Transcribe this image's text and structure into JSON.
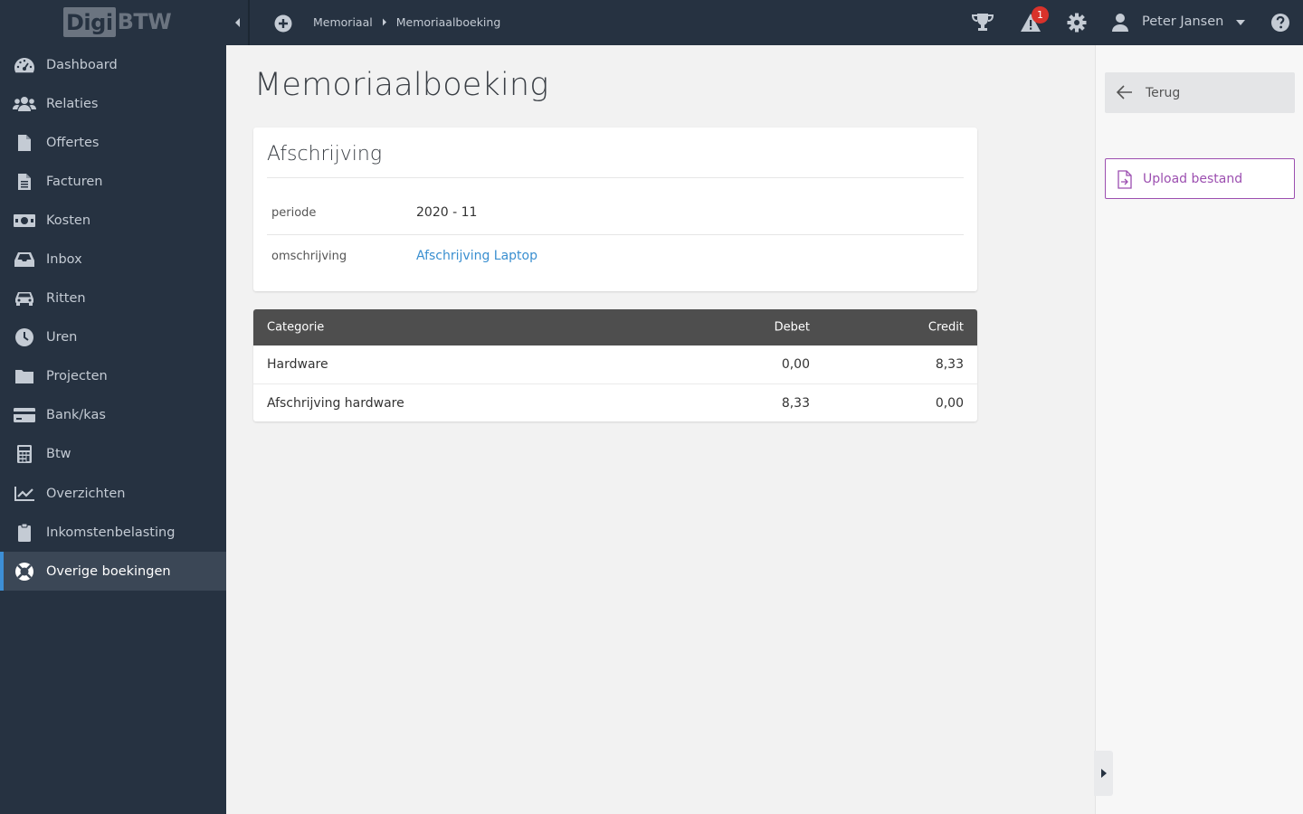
{
  "logo": {
    "part1": "Digi",
    "part2": "BTW"
  },
  "sidebar": {
    "items": [
      {
        "label": "Dashboard",
        "icon": "dashboard-icon"
      },
      {
        "label": "Relaties",
        "icon": "users-icon"
      },
      {
        "label": "Offertes",
        "icon": "file-icon"
      },
      {
        "label": "Facturen",
        "icon": "file-text-icon"
      },
      {
        "label": "Kosten",
        "icon": "money-icon"
      },
      {
        "label": "Inbox",
        "icon": "inbox-icon"
      },
      {
        "label": "Ritten",
        "icon": "car-icon"
      },
      {
        "label": "Uren",
        "icon": "clock-icon"
      },
      {
        "label": "Projecten",
        "icon": "folder-icon"
      },
      {
        "label": "Bank/kas",
        "icon": "credit-card-icon"
      },
      {
        "label": "Btw",
        "icon": "calculator-icon"
      },
      {
        "label": "Overzichten",
        "icon": "chart-line-icon"
      },
      {
        "label": "Inkomstenbelasting",
        "icon": "clipboard-icon"
      },
      {
        "label": "Overige boekingen",
        "icon": "life-ring-icon",
        "active": true
      }
    ]
  },
  "topbar": {
    "breadcrumb": [
      "Memoriaal",
      "Memoriaalboeking"
    ],
    "notification_count": "1",
    "user_name": "Peter Jansen"
  },
  "main": {
    "title": "Memoriaalboeking",
    "card": {
      "title": "Afschrijving",
      "fields": [
        {
          "label": "periode",
          "value": "2020 - 11"
        },
        {
          "label": "omschrijving",
          "value": "Afschrijving Laptop"
        }
      ]
    },
    "table": {
      "headers": {
        "category": "Categorie",
        "debit": "Debet",
        "credit": "Credit"
      },
      "rows": [
        {
          "category": "Hardware",
          "debit": "0,00",
          "credit": "8,33"
        },
        {
          "category": "Afschrijving hardware",
          "debit": "8,33",
          "credit": "0,00"
        }
      ]
    }
  },
  "right_panel": {
    "back_label": "Terug",
    "upload_label": "Upload bestand"
  },
  "colors": {
    "sidebar_bg": "#263241",
    "active_accent": "#3d8fd6",
    "link": "#3a8fd0",
    "upload_accent": "#9c4fb0",
    "table_header_bg": "#4e4e4e",
    "badge": "#d9322b"
  }
}
